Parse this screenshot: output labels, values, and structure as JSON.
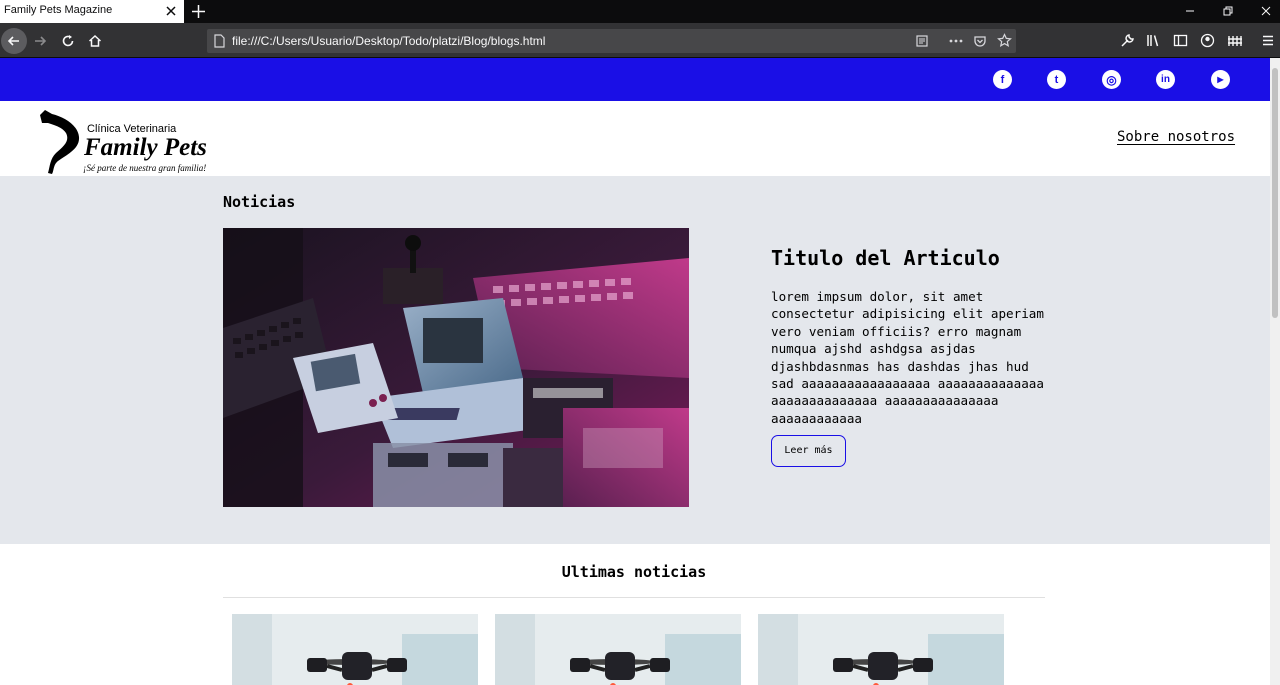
{
  "browser": {
    "tab_title": "Family Pets Magazine",
    "url": "file:///C:/Users/Usuario/Desktop/Todo/platzi/Blog/blogs.html"
  },
  "social": [
    {
      "name": "facebook",
      "glyph": "f"
    },
    {
      "name": "tumblr",
      "glyph": "t"
    },
    {
      "name": "instagram",
      "glyph": "◎"
    },
    {
      "name": "linkedin",
      "glyph": "in"
    },
    {
      "name": "youtube",
      "glyph": "▶"
    }
  ],
  "logo": {
    "line1": "Clínica Veterinaria",
    "line2": "Family Pets",
    "line3": "¡Sé parte de nuestra gran familia!"
  },
  "header": {
    "about_link": "Sobre nosotros"
  },
  "featured": {
    "section_label": "Noticias",
    "title": "Titulo del Articulo",
    "body": "lorem impsum dolor, sit amet consectetur adipisicing elit aperiam vero veniam officiis? erro magnam numqua ajshd ashdgsa asjdas djashbdasnmas has dashdas jhas hud sad aaaaaaaaaaaaaaaaa aaaaaaaaaaaaaa aaaaaaaaaaaaaa aaaaaaaaaaaaaaa aaaaaaaaaaaa",
    "button": "Leer más"
  },
  "latest": {
    "title": "Ultimas noticias"
  },
  "colors": {
    "brand": "#1a0fe6",
    "featured_bg": "#e4e7ec"
  }
}
